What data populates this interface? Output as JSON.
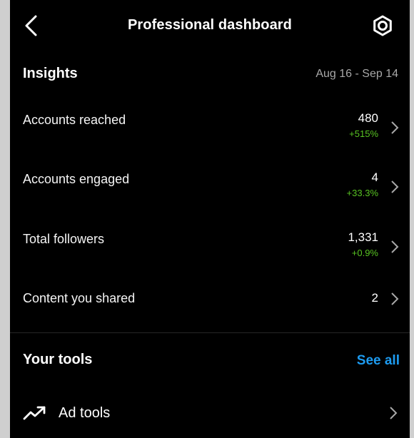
{
  "header": {
    "title": "Professional dashboard",
    "back_icon": "chevron-left-icon",
    "settings_icon": "settings-icon"
  },
  "insights": {
    "title": "Insights",
    "date_range": "Aug 16 - Sep 14",
    "metrics": [
      {
        "label": "Accounts reached",
        "value": "480",
        "change": "+515%"
      },
      {
        "label": "Accounts engaged",
        "value": "4",
        "change": "+33.3%"
      },
      {
        "label": "Total followers",
        "value": "1,331",
        "change": "+0.9%"
      },
      {
        "label": "Content you shared",
        "value": "2",
        "change": ""
      }
    ]
  },
  "tools": {
    "title": "Your tools",
    "see_all": "See all",
    "items": [
      {
        "label": "Ad tools",
        "icon": "trending-up-icon"
      }
    ]
  },
  "colors": {
    "background": "#000000",
    "positive_change": "#58c322",
    "link": "#1d9bf0",
    "muted_text": "#a8a8a8"
  }
}
